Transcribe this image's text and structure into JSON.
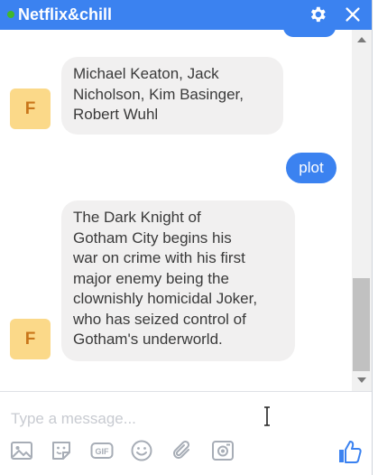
{
  "header": {
    "title": "Netflix&chill",
    "status_color": "#42b72a",
    "accent": "#3b82f0",
    "icons": [
      "gear-icon",
      "close-icon"
    ]
  },
  "conversation": {
    "messages": [
      {
        "from": "bot",
        "avatar_letter": "F",
        "text": "Michael Keaton, Jack\nNicholson, Kim Basinger,\nRobert Wuhl"
      },
      {
        "from": "user",
        "text": "plot"
      },
      {
        "from": "bot",
        "avatar_letter": "F",
        "text": "The Dark Knight of\nGotham City begins his\nwar on crime with his first\nmajor enemy being the\nclownishly homicidal Joker,\nwho has seized control of\nGotham's underworld."
      }
    ]
  },
  "composer": {
    "placeholder": "Type a message...",
    "gif_label": "GIF",
    "tools": [
      "image-icon",
      "sticker-icon",
      "gif-icon",
      "emoji-icon",
      "attachment-icon",
      "camera-icon"
    ],
    "send": "like-icon"
  }
}
